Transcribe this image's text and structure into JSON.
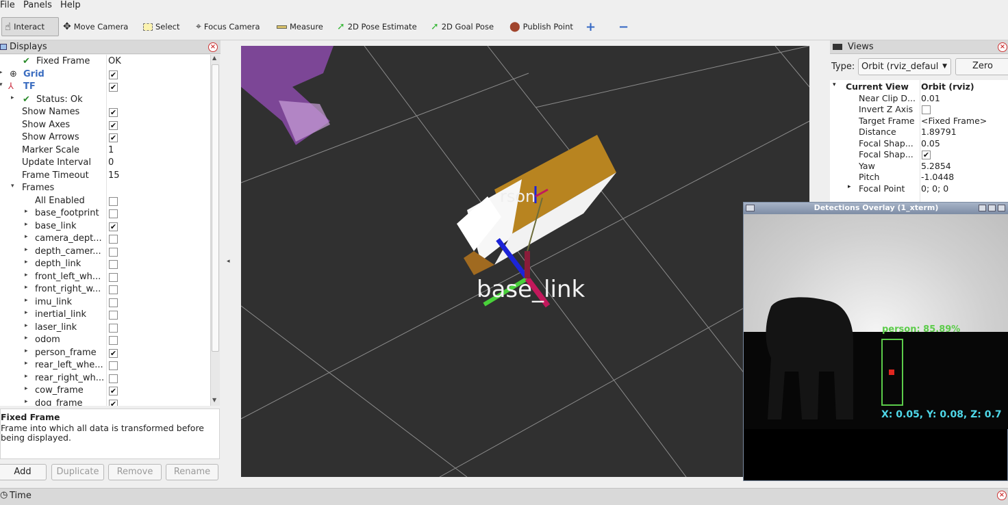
{
  "menu": [
    "File",
    "Panels",
    "Help"
  ],
  "toolbar": {
    "interact": "Interact",
    "move_camera": "Move Camera",
    "select": "Select",
    "focus_camera": "Focus Camera",
    "measure": "Measure",
    "pose_estimate": "2D Pose Estimate",
    "goal_pose": "2D Goal Pose",
    "publish_point": "Publish Point"
  },
  "displays": {
    "title": "Displays",
    "rows": [
      {
        "label": "Fixed Frame",
        "value": "OK"
      },
      {
        "label": "Grid"
      },
      {
        "label": "TF"
      },
      {
        "label": "Status: Ok"
      },
      {
        "label": "Show Names"
      },
      {
        "label": "Show Axes"
      },
      {
        "label": "Show Arrows"
      },
      {
        "label": "Marker Scale",
        "value": "1"
      },
      {
        "label": "Update Interval",
        "value": "0"
      },
      {
        "label": "Frame Timeout",
        "value": "15"
      },
      {
        "label": "Frames"
      },
      {
        "label": "All Enabled"
      },
      {
        "label": "base_footprint"
      },
      {
        "label": "base_link"
      },
      {
        "label": "camera_dept..."
      },
      {
        "label": "depth_camer..."
      },
      {
        "label": "depth_link"
      },
      {
        "label": "front_left_wh..."
      },
      {
        "label": "front_right_w..."
      },
      {
        "label": "imu_link"
      },
      {
        "label": "inertial_link"
      },
      {
        "label": "laser_link"
      },
      {
        "label": "odom"
      },
      {
        "label": "person_frame"
      },
      {
        "label": "rear_left_whe..."
      },
      {
        "label": "rear_right_wh..."
      },
      {
        "label": "cow_frame"
      },
      {
        "label": "dog_frame"
      }
    ],
    "desc_title": "Fixed Frame",
    "desc_line1": "Frame into which all data is transformed before",
    "desc_line2": "being displayed.",
    "buttons": {
      "add": "Add",
      "duplicate": "Duplicate",
      "remove": "Remove",
      "rename": "Rename"
    }
  },
  "views": {
    "title": "Views",
    "type_label": "Type:",
    "type_value": "Orbit (rviz_defaul",
    "zero": "Zero",
    "rows": [
      {
        "label": "Current View",
        "value": "Orbit (rviz)"
      },
      {
        "label": "Near Clip D...",
        "value": "0.01"
      },
      {
        "label": "Invert Z Axis",
        "value": ""
      },
      {
        "label": "Target Frame",
        "value": "<Fixed Frame>"
      },
      {
        "label": "Distance",
        "value": "1.89791"
      },
      {
        "label": "Focal Shap...",
        "value": "0.05"
      },
      {
        "label": "Focal Shap...",
        "value": ""
      },
      {
        "label": "Yaw",
        "value": "5.2854"
      },
      {
        "label": "Pitch",
        "value": "-1.0448"
      },
      {
        "label": "Focal Point",
        "value": "0; 0; 0"
      }
    ]
  },
  "viewport": {
    "label_base": "base_link",
    "label_rson": "rson"
  },
  "overlay": {
    "title": "Detections Overlay (1_xterm)",
    "detection": "person: 85.89%",
    "coords": "X: 0.05, Y: 0.08, Z: 0.7"
  },
  "time": {
    "title": "Time"
  }
}
